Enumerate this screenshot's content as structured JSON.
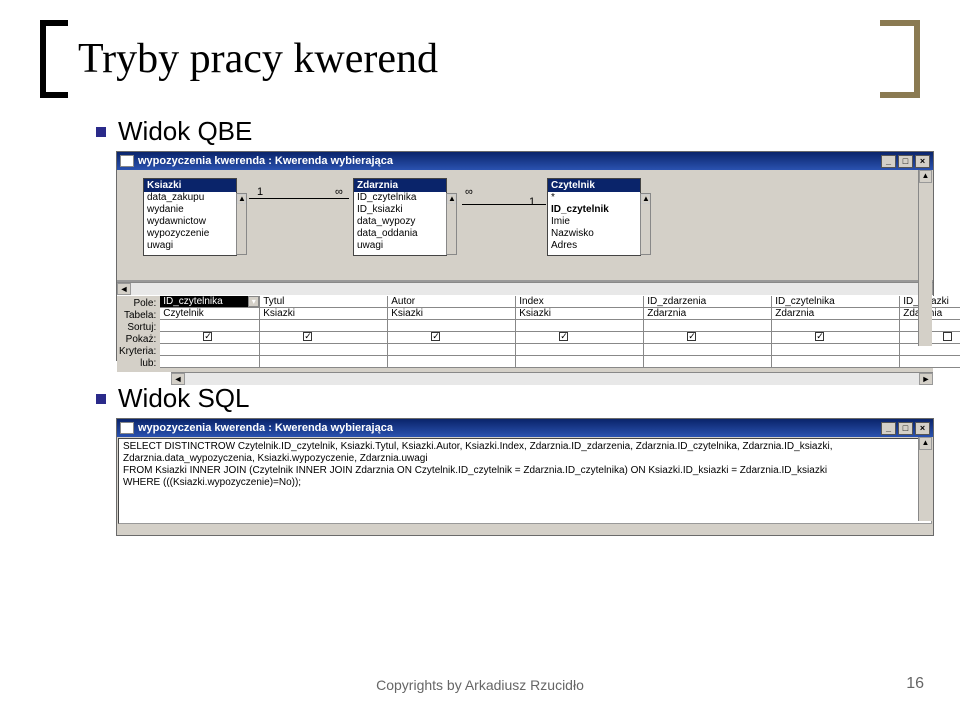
{
  "title": "Tryby pracy kwerend",
  "bullets": {
    "qbe": "Widok QBE",
    "sql": "Widok SQL"
  },
  "window_title": "wypozyczenia kwerenda : Kwerenda wybierająca",
  "qbe": {
    "tables": {
      "ksiazki": {
        "name": "Ksiazki",
        "fields": [
          "data_zakupu",
          "wydanie",
          "wydawnictow",
          "wypozyczenie",
          "uwagi"
        ]
      },
      "zdarznia": {
        "name": "Zdarznia",
        "fields": [
          "ID_czytelnika",
          "ID_ksiazki",
          "data_wypozy",
          "data_oddania",
          "uwagi"
        ]
      },
      "czytelnik": {
        "name": "Czytelnik",
        "fields": [
          "*",
          "ID_czytelnik",
          "Imie",
          "Nazwisko",
          "Adres"
        ]
      }
    },
    "rel": {
      "one1": "1",
      "inf1": "∞",
      "one2": "1",
      "inf2": "∞"
    },
    "labels": {
      "pole": "Pole:",
      "tabela": "Tabela:",
      "sortuj": "Sortuj:",
      "pokaz": "Pokaż:",
      "kryteria": "Kryteria:",
      "lub": "lub:"
    },
    "cols": [
      {
        "pole": "ID_czytelnika",
        "tabela": "Czytelnik",
        "show": true,
        "sel": true
      },
      {
        "pole": "Tytul",
        "tabela": "Ksiazki",
        "show": true
      },
      {
        "pole": "Autor",
        "tabela": "Ksiazki",
        "show": true
      },
      {
        "pole": "Index",
        "tabela": "Ksiazki",
        "show": true
      },
      {
        "pole": "ID_zdarzenia",
        "tabela": "Zdarznia",
        "show": true
      },
      {
        "pole": "ID_czytelnika",
        "tabela": "Zdarznia",
        "show": true
      },
      {
        "pole": "ID_ksiazki",
        "tabela": "Zdarznia",
        "show": false
      }
    ]
  },
  "sql": {
    "l1": "SELECT DISTINCTROW Czytelnik.ID_czytelnik, Ksiazki.Tytul, Ksiazki.Autor, Ksiazki.Index, Zdarznia.ID_zdarzenia, Zdarznia.ID_czytelnika, Zdarznia.ID_ksiazki,",
    "l2": "Zdarznia.data_wypozyczenia, Ksiazki.wypozyczenie, Zdarznia.uwagi",
    "l3": "FROM Ksiazki INNER JOIN (Czytelnik INNER JOIN Zdarznia ON Czytelnik.ID_czytelnik = Zdarznia.ID_czytelnika) ON Ksiazki.ID_ksiazki = Zdarznia.ID_ksiazki",
    "l4": "WHERE (((Ksiazki.wypozyczenie)=No));"
  },
  "footer": {
    "copyright": "Copyrights by Arkadiusz Rzucidło",
    "page": "16"
  },
  "winbtns": {
    "min": "_",
    "max": "□",
    "close": "×"
  }
}
